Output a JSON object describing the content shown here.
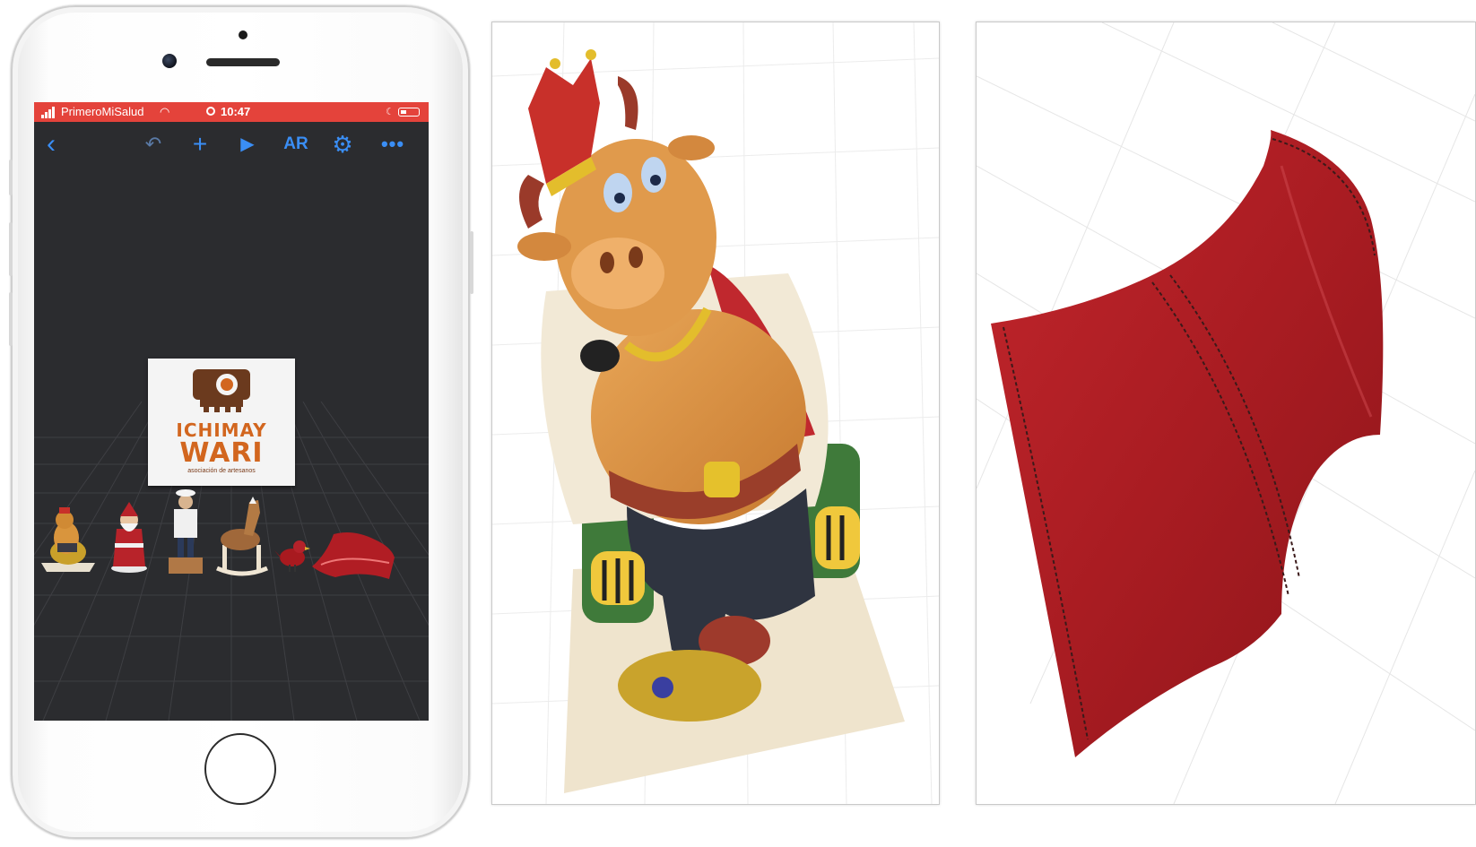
{
  "phone": {
    "status_bar": {
      "carrier": "PrimeroMiSalud",
      "time": "10:47"
    },
    "toolbar": {
      "back_icon": "chevron-left",
      "undo_icon": "undo-arrow",
      "add_icon": "plus",
      "play_icon": "play-triangle",
      "ar_label": "AR",
      "settings_icon": "gear",
      "more_icon": "ellipsis"
    },
    "scene": {
      "logo": {
        "line1": "ICHIMAY",
        "line2": "WARI",
        "subtitle": "asociación de artesanos"
      },
      "models": [
        "king-bull-figurine",
        "santa-figurine",
        "sailor-figurine",
        "rocking-horse-figurine",
        "red-bird-figurine",
        "red-leather-piece"
      ]
    }
  },
  "panels": {
    "middle": {
      "model": "king-bull-figurine-3d-scan"
    },
    "right": {
      "model": "red-leather-piece-3d-scan"
    }
  },
  "colors": {
    "status_bar": "#e4433b",
    "toolbar_accent": "#3a8ef5",
    "viewport_bg": "#2b2c2f",
    "logo_orange": "#d2661f",
    "leather_red": "#b11d24"
  }
}
